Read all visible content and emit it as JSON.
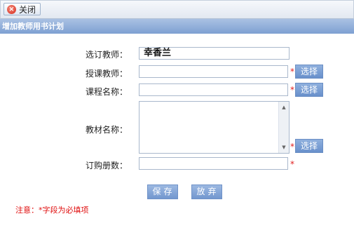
{
  "toolbar": {
    "close_label": "关闭",
    "close_icon": "close-icon"
  },
  "panel": {
    "title": "增加教师用书计划"
  },
  "form": {
    "teacher_label": "选订教师：",
    "teacher_value": "幸香兰",
    "lecturer_label": "授课教师：",
    "course_label": "课程名称：",
    "textbook_label": "教材名称：",
    "quantity_label": "订购册数：",
    "required_mark": "*",
    "select_label": "选择"
  },
  "actions": {
    "save_label": "保存",
    "discard_label": "放弃"
  },
  "note": "注意：*字段为必填项",
  "colors": {
    "header": "#8aaad8",
    "button": "#7a9dd2",
    "required": "#e02020"
  }
}
